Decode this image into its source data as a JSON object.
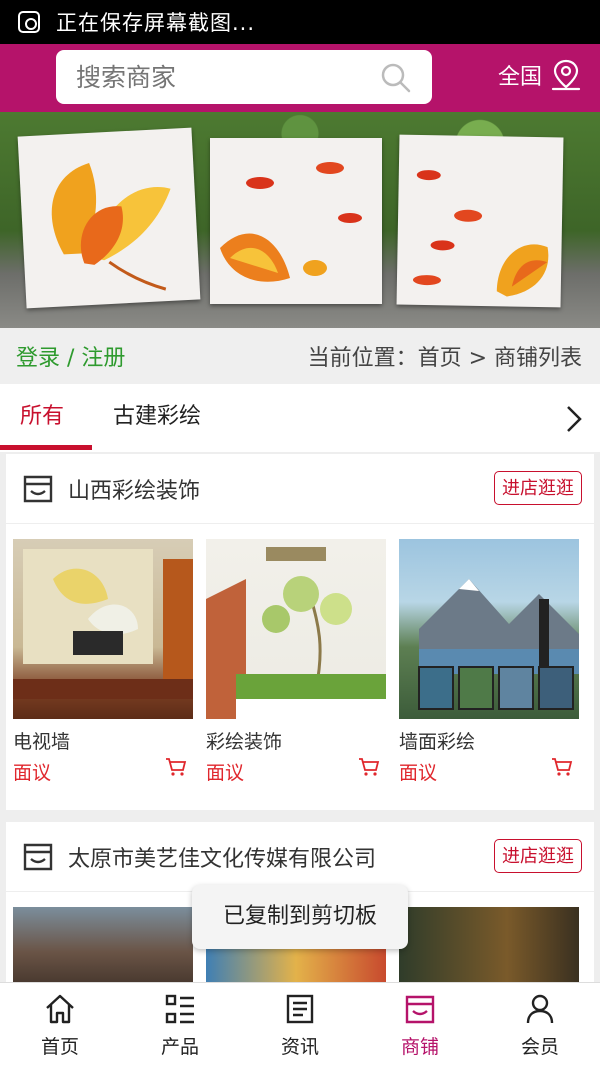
{
  "status_bar": {
    "text": "正在保存屏幕截图..."
  },
  "header": {
    "search_placeholder": "搜索商家",
    "region_label": "全国"
  },
  "crumb_bar": {
    "login_label": "登录 / 注册",
    "location_text": "当前位置：首页 > 商铺列表"
  },
  "tabs": [
    {
      "label": "所有"
    },
    {
      "label": "古建彩绘"
    }
  ],
  "shops": [
    {
      "name": "山西彩绘装饰",
      "visit_label": "进店逛逛",
      "products": [
        {
          "name": "电视墙",
          "price": "面议"
        },
        {
          "name": "彩绘装饰",
          "price": "面议"
        },
        {
          "name": "墙面彩绘",
          "price": "面议"
        }
      ]
    },
    {
      "name": "太原市美艺佳文化传媒有限公司",
      "visit_label": "进店逛逛"
    }
  ],
  "toast": {
    "text": "已复制到剪切板"
  },
  "bottom_nav": [
    {
      "label": "首页",
      "icon": "home-icon"
    },
    {
      "label": "产品",
      "icon": "grid-icon"
    },
    {
      "label": "资讯",
      "icon": "news-icon"
    },
    {
      "label": "商铺",
      "icon": "store-icon"
    },
    {
      "label": "会员",
      "icon": "user-icon"
    }
  ],
  "colors": {
    "brand": "#b5136a",
    "accent_red": "#c8102e",
    "login_green": "#2e9a2e"
  }
}
